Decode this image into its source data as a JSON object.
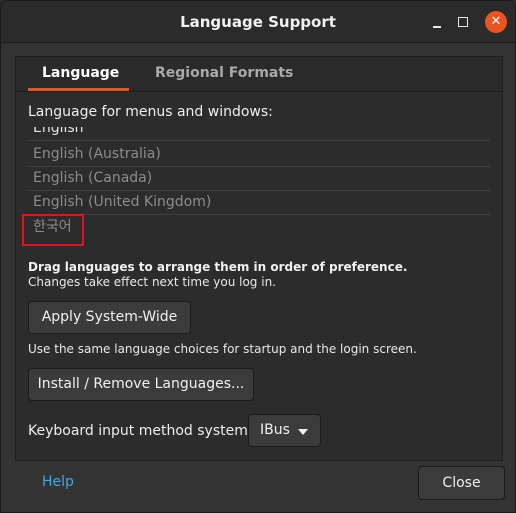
{
  "window": {
    "title": "Language Support",
    "controls": {
      "minimize": "minimize-icon",
      "maximize": "maximize-icon",
      "close": "close-icon",
      "close_glyph": "✕"
    }
  },
  "tabs": [
    {
      "label": "Language",
      "active": true
    },
    {
      "label": "Regional Formats",
      "active": false
    }
  ],
  "language_tab": {
    "section_label": "Language for menus and windows:",
    "languages": [
      {
        "label": "English",
        "dimmed": false
      },
      {
        "label": "English (Australia)",
        "dimmed": true
      },
      {
        "label": "English (Canada)",
        "dimmed": true
      },
      {
        "label": "English (United Kingdom)",
        "dimmed": true
      },
      {
        "label": "한국어",
        "dimmed": true
      }
    ],
    "hint_bold": "Drag languages to arrange them in order of preference.",
    "hint": "Changes take effect next time you log in.",
    "apply_button": "Apply System-Wide",
    "apply_note": "Use the same language choices for startup and the login screen.",
    "install_button": "Install / Remove Languages...",
    "keyboard_label": "Keyboard input method system:",
    "keyboard_value": "IBus"
  },
  "footer": {
    "help": "Help",
    "close": "Close"
  },
  "colors": {
    "accent": "#e95420",
    "link": "#3fa9e0",
    "highlight_box": "#e0141c"
  }
}
